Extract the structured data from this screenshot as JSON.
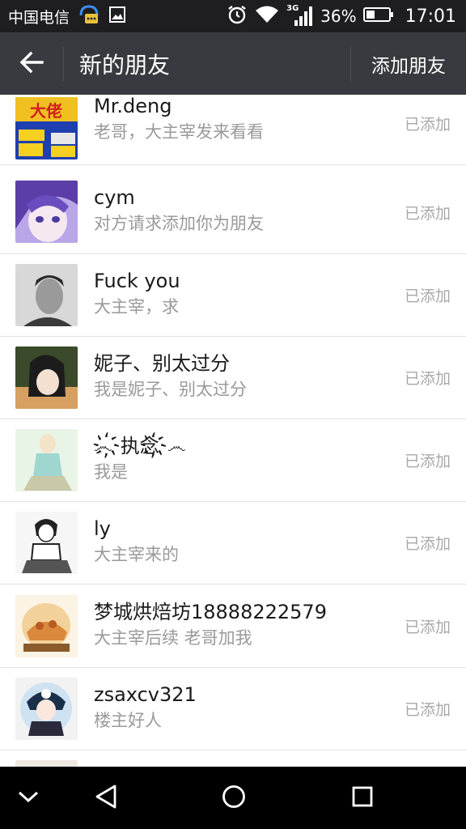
{
  "status_bar": {
    "carrier": "中国电信",
    "network_type": "3G",
    "battery": "36%",
    "time": "17:01",
    "icons": [
      "chat-notification-icon",
      "image-icon",
      "alarm-icon",
      "wifi-icon",
      "signal-icon",
      "battery-icon"
    ]
  },
  "header": {
    "back_icon": "arrow-left-icon",
    "title": "新的朋友",
    "add_friend_label": "添加朋友"
  },
  "requests": [
    {
      "name": "Mr.deng",
      "message": "老哥，大主宰发来看看",
      "status": "已添加",
      "avatar": "poster-avatar"
    },
    {
      "name": "cym",
      "message": "对方请求添加你为朋友",
      "status": "已添加",
      "avatar": "anime-girl-avatar"
    },
    {
      "name": "Fuck  you",
      "message": "大主宰，求",
      "status": "已添加",
      "avatar": "photo-avatar"
    },
    {
      "name": "妮子、别太过分",
      "message": "我是妮子、别太过分",
      "status": "已添加",
      "avatar": "anime-avatar"
    },
    {
      "name": "෴҉执念҉෴",
      "message": "我是",
      "status": "已添加",
      "avatar": "sketch-avatar"
    },
    {
      "name": "ly",
      "message": "大主宰来的",
      "status": "已添加",
      "avatar": "manga-avatar"
    },
    {
      "name": "梦城烘焙坊18888222579",
      "message": "大主宰后续 老哥加我",
      "status": "已添加",
      "avatar": "bakery-logo-avatar"
    },
    {
      "name": "zsaxcv321",
      "message": "楼主好人",
      "status": "已添加",
      "avatar": "chibi-avatar"
    }
  ],
  "nav_bar": {
    "icons": [
      "chevron-down-icon",
      "back-triangle-icon",
      "home-circle-icon",
      "recents-square-icon"
    ]
  },
  "colors": {
    "status_bar": "#1e1e21",
    "app_bar": "#393a3f",
    "divider": "#e2e2e2",
    "name_text": "#1a1a1a",
    "sub_text": "#9a9a9a"
  }
}
